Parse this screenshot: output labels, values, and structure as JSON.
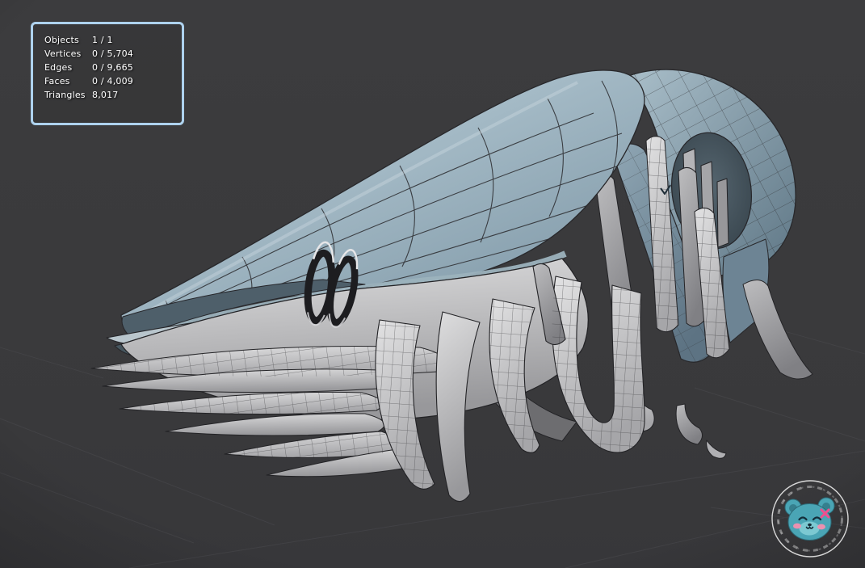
{
  "stats_panel": {
    "border_color": "#aed2ee",
    "text_color": "#ffffff",
    "rows": [
      {
        "label": "Objects",
        "value": "1 / 1"
      },
      {
        "label": "Vertices",
        "value": "0 / 5,704"
      },
      {
        "label": "Edges",
        "value": "0 / 9,665"
      },
      {
        "label": "Faces",
        "value": "0 / 4,009"
      },
      {
        "label": "Triangles",
        "value": "8,017"
      }
    ]
  },
  "viewport": {
    "background_color": "#3a3a3c",
    "grid_line_color": "#4b4b4f",
    "model": {
      "hood_color": "#a4b9c5",
      "hood_shadow_color": "#46565f",
      "tentacle_color": "#d0d0d2",
      "wireframe_color": "#2b2b2e",
      "piercing_ring_color": "#1d1d20"
    }
  },
  "watermark": {
    "icon": "bear-logo",
    "ring_color": "#eaeaea",
    "bear_color": "#4aa5b5",
    "muzzle_color": "#7ecad4",
    "blush_color": "#f28fb0",
    "cross_color": "#ef4f8f",
    "feature_color": "#142e3a"
  }
}
